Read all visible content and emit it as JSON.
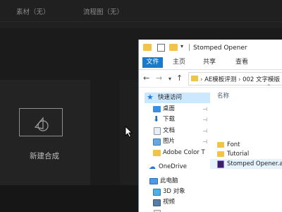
{
  "ae": {
    "tabs": [
      "素材（无）",
      "流程图（无）"
    ],
    "new_comp_label": "新建合成"
  },
  "explorer": {
    "title": "Stomped Opener",
    "ribbon_tabs": [
      "文件",
      "主页",
      "共享",
      "查看"
    ],
    "address": {
      "segments": [
        "AE模板评测",
        "002 文字模版"
      ]
    },
    "nav_items": [
      {
        "label": "快速访问",
        "icon": "star-icon",
        "pinned": false
      },
      {
        "label": "桌面",
        "icon": "desktop-icon",
        "pinned": true
      },
      {
        "label": "下载",
        "icon": "download-icon",
        "pinned": true
      },
      {
        "label": "文档",
        "icon": "document-icon",
        "pinned": true
      },
      {
        "label": "图片",
        "icon": "pictures-icon",
        "pinned": true
      },
      {
        "label": "Adobe Color T",
        "icon": "folder-icon",
        "pinned": false
      },
      {
        "label": "OneDrive",
        "icon": "cloud-icon",
        "pinned": false
      },
      {
        "label": "此电脑",
        "icon": "computer-icon",
        "pinned": false
      },
      {
        "label": "3D 对象",
        "icon": "3d-objects-icon",
        "pinned": false
      },
      {
        "label": "视频",
        "icon": "video-icon",
        "pinned": false
      }
    ],
    "column_header": "名称",
    "files": [
      {
        "name": "Font",
        "type": "folder"
      },
      {
        "name": "Tutorial",
        "type": "folder"
      },
      {
        "name": "Stomped Opener.aep",
        "type": "aep"
      }
    ]
  }
}
